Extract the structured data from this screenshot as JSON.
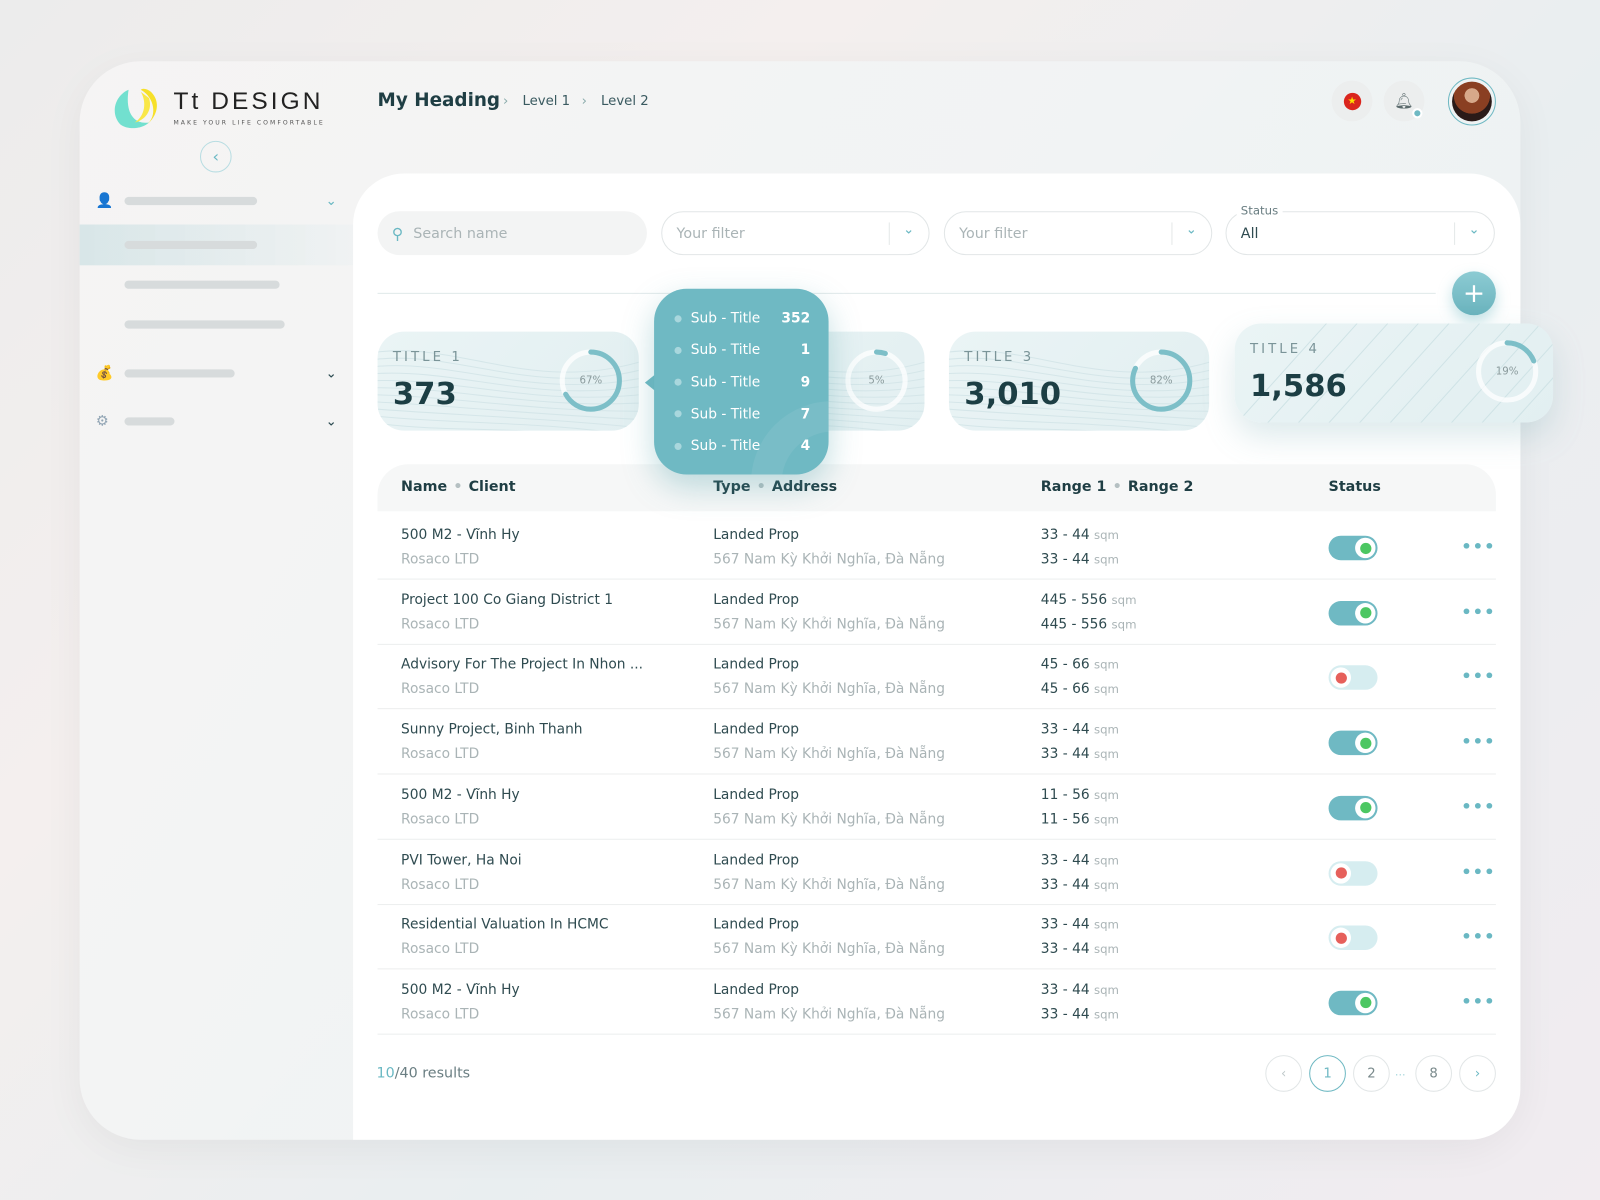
{
  "brand": {
    "name": "Tt DESIGN",
    "tagline": "MAKE YOUR LIFE COMFORTABLE"
  },
  "header": {
    "title": "My Heading",
    "breadcrumbs": [
      "Level 1",
      "Level 2"
    ],
    "flag_icon": "vietnam-flag-icon",
    "bell_icon": "bell-icon",
    "notification_dot": true
  },
  "sidebar": {
    "items": [
      {
        "icon": "user-icon",
        "expanded": true
      },
      {
        "icon": "finance-icon",
        "expanded": false
      },
      {
        "icon": "settings-icon",
        "expanded": false
      }
    ]
  },
  "filters": {
    "search_placeholder": "Search name",
    "filter1_placeholder": "Your filter",
    "filter2_placeholder": "Your filter",
    "status_label": "Status",
    "status_value": "All"
  },
  "stats": [
    {
      "title": "TITLE 1",
      "value": "373",
      "percent": 67,
      "percent_label": "67%"
    },
    {
      "title": "",
      "value": "",
      "percent": 5,
      "percent_label": "5%"
    },
    {
      "title": "TITLE 3",
      "value": "3,010",
      "percent": 82,
      "percent_label": "82%"
    },
    {
      "title": "TITLE 4",
      "value": "1,586",
      "percent": 19,
      "percent_label": "19%"
    }
  ],
  "tooltip": {
    "items": [
      {
        "label": "Sub - Title",
        "value": "352"
      },
      {
        "label": "Sub - Title",
        "value": "1"
      },
      {
        "label": "Sub - Title",
        "value": "9"
      },
      {
        "label": "Sub - Title",
        "value": "7"
      },
      {
        "label": "Sub - Title",
        "value": "4"
      }
    ]
  },
  "table": {
    "headers": {
      "name": "Name",
      "client": "Client",
      "type": "Type",
      "address": "Address",
      "range1": "Range 1",
      "range2": "Range 2",
      "status": "Status"
    },
    "unit": "sqm",
    "rows": [
      {
        "name": "500 M2 - Vĩnh Hy",
        "client": "Rosaco LTD",
        "type": "Landed Prop",
        "address": "567 Nam Kỳ Khởi Nghĩa, Đà Nẵng",
        "range1": "33 - 44",
        "range2": "33 - 44",
        "active": true
      },
      {
        "name": "Project 100 Co Giang District 1",
        "client": "Rosaco LTD",
        "type": "Landed Prop",
        "address": "567 Nam Kỳ Khởi Nghĩa, Đà Nẵng",
        "range1": "445 - 556",
        "range2": "445 - 556",
        "active": true
      },
      {
        "name": "Advisory For The Project In Nhon ...",
        "client": "Rosaco LTD",
        "type": "Landed Prop",
        "address": "567 Nam Kỳ Khởi Nghĩa, Đà Nẵng",
        "range1": "45 - 66",
        "range2": "45 - 66",
        "active": false
      },
      {
        "name": "Sunny Project, Binh Thanh",
        "client": "Rosaco LTD",
        "type": "Landed Prop",
        "address": "567 Nam Kỳ Khởi Nghĩa, Đà Nẵng",
        "range1": "33 - 44",
        "range2": "33 - 44",
        "active": true
      },
      {
        "name": "500 M2 - Vĩnh Hy",
        "client": "Rosaco LTD",
        "type": "Landed Prop",
        "address": "567 Nam Kỳ Khởi Nghĩa, Đà Nẵng",
        "range1": "11 - 56",
        "range2": "11 - 56",
        "active": true
      },
      {
        "name": "PVI Tower, Ha Noi",
        "client": "Rosaco LTD",
        "type": "Landed Prop",
        "address": "567 Nam Kỳ Khởi Nghĩa, Đà Nẵng",
        "range1": "33 - 44",
        "range2": "33 - 44",
        "active": false
      },
      {
        "name": "Residential Valuation In HCMC",
        "client": "Rosaco LTD",
        "type": "Landed Prop",
        "address": "567 Nam Kỳ Khởi Nghĩa, Đà Nẵng",
        "range1": "33 - 44",
        "range2": "33 - 44",
        "active": false
      },
      {
        "name": "500 M2 - Vĩnh Hy",
        "client": "Rosaco LTD",
        "type": "Landed Prop",
        "address": "567 Nam Kỳ Khởi Nghĩa, Đà Nẵng",
        "range1": "33 - 44",
        "range2": "33 - 44",
        "active": true
      }
    ]
  },
  "footer": {
    "shown": "10",
    "total": "/40 results",
    "pages": [
      "1",
      "2",
      "...",
      "8"
    ],
    "current_page": "1"
  },
  "colors": {
    "accent": "#6fb9c3",
    "on": "#4cc762",
    "off": "#e6605b",
    "text": "#1f3e44"
  }
}
